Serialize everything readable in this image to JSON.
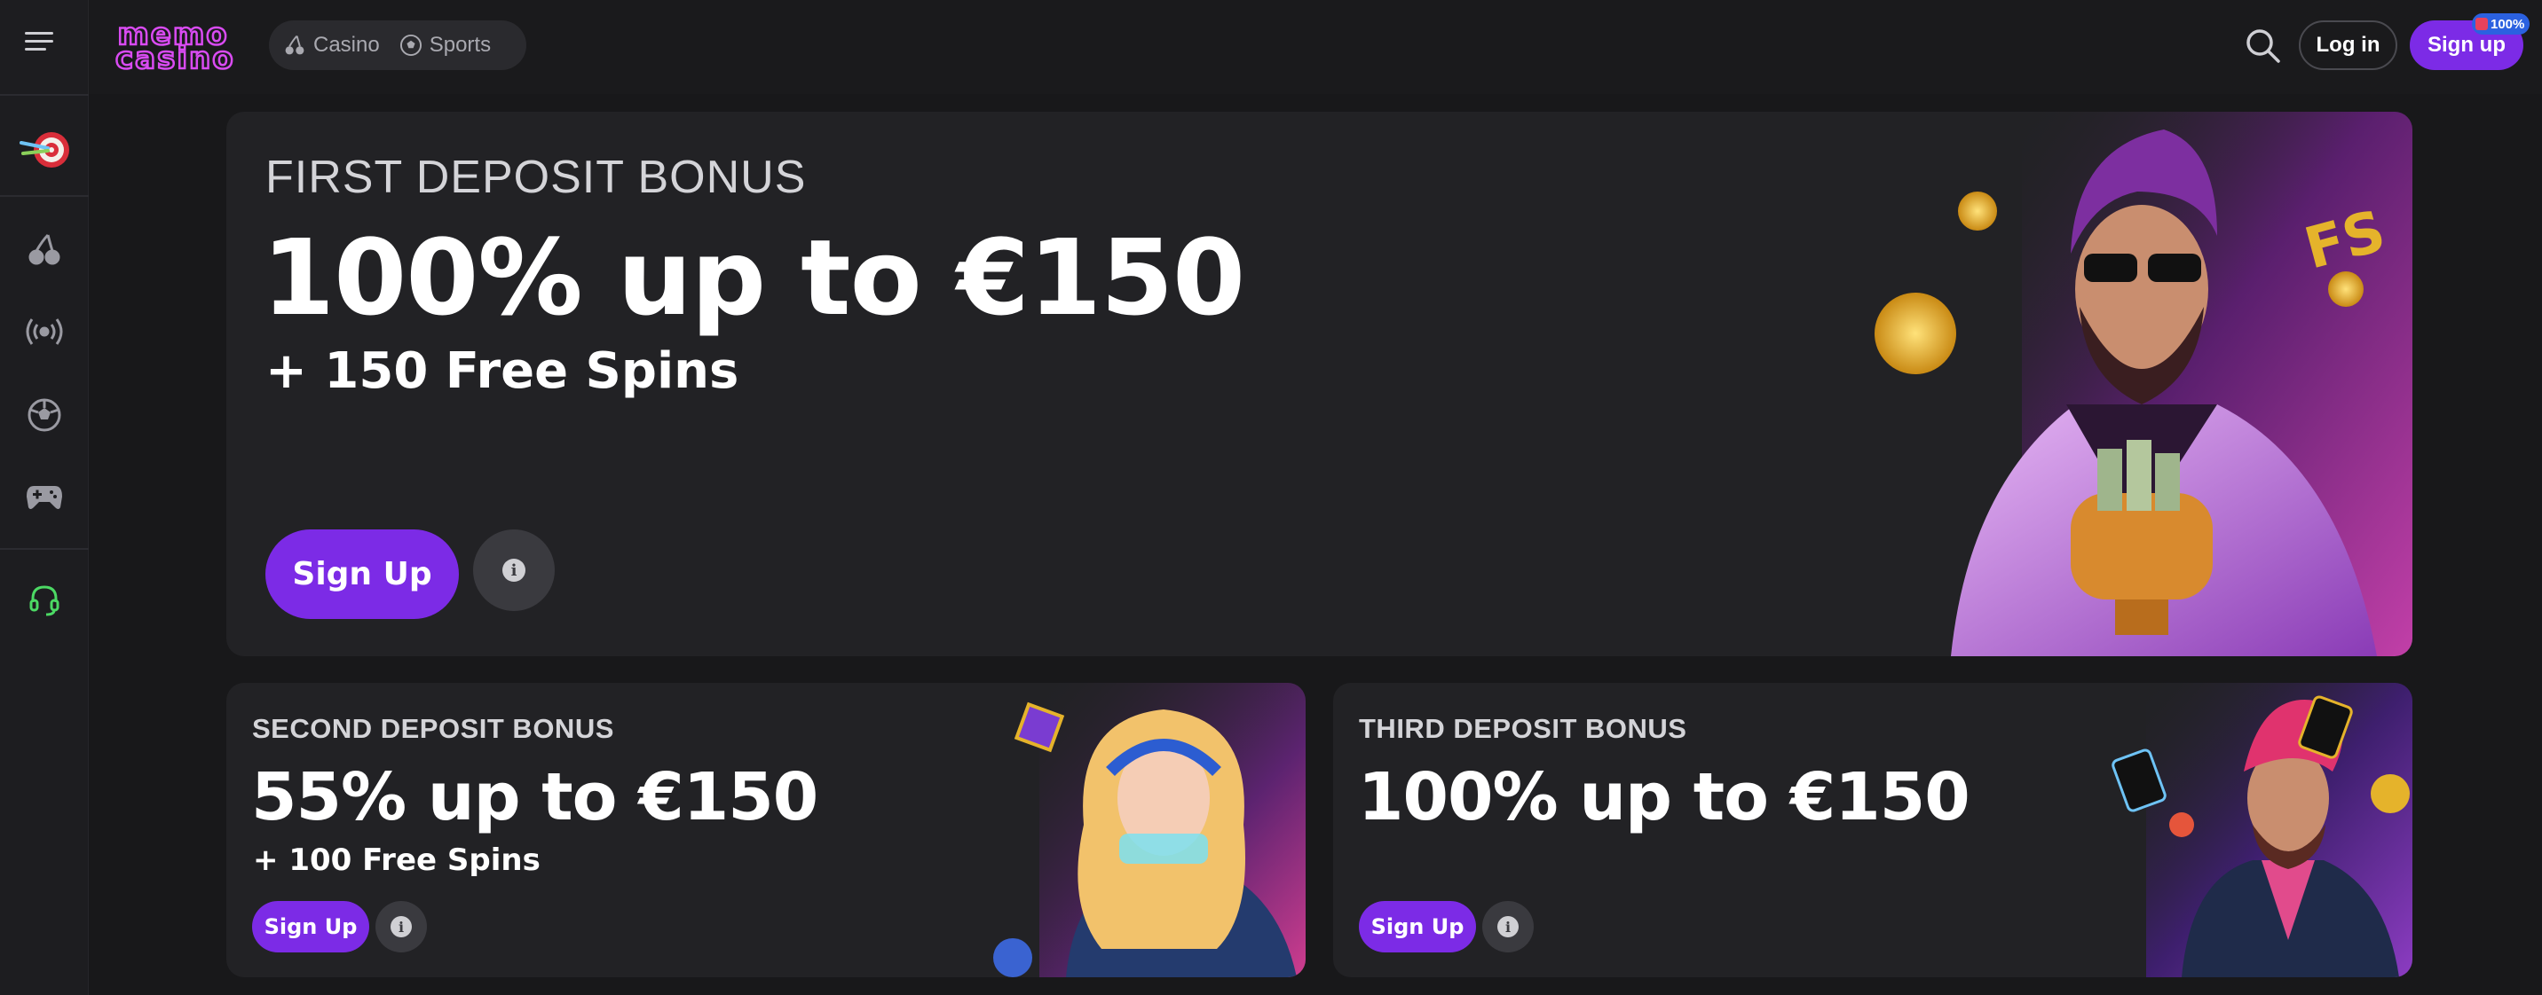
{
  "brand": {
    "logo_line1": "memo",
    "logo_line2": "casino"
  },
  "nav": {
    "casino": "Casino",
    "sports": "Sports"
  },
  "header": {
    "login": "Log in",
    "signup": "Sign up",
    "badge": "100%"
  },
  "sidebar": {
    "items": [
      "darts-icon",
      "cherries-icon",
      "live-icon",
      "football-icon",
      "gamepad-icon",
      "support-icon"
    ]
  },
  "bonuses": {
    "first": {
      "title": "FIRST DEPOSIT BONUS",
      "headline": "100% up to €150",
      "extra": "+ 150 Free Spins",
      "cta": "Sign Up"
    },
    "second": {
      "title": "SECOND DEPOSIT BONUS",
      "headline": "55% up to €150",
      "extra": "+ 100 Free Spins",
      "cta": "Sign Up"
    },
    "third": {
      "title": "THIRD DEPOSIT BONUS",
      "headline": "100% up to €150",
      "cta": "Sign Up"
    }
  },
  "colors": {
    "accent": "#7c2be6",
    "logo": "#d94bf2",
    "background": "#18181a",
    "card": "#222225"
  }
}
